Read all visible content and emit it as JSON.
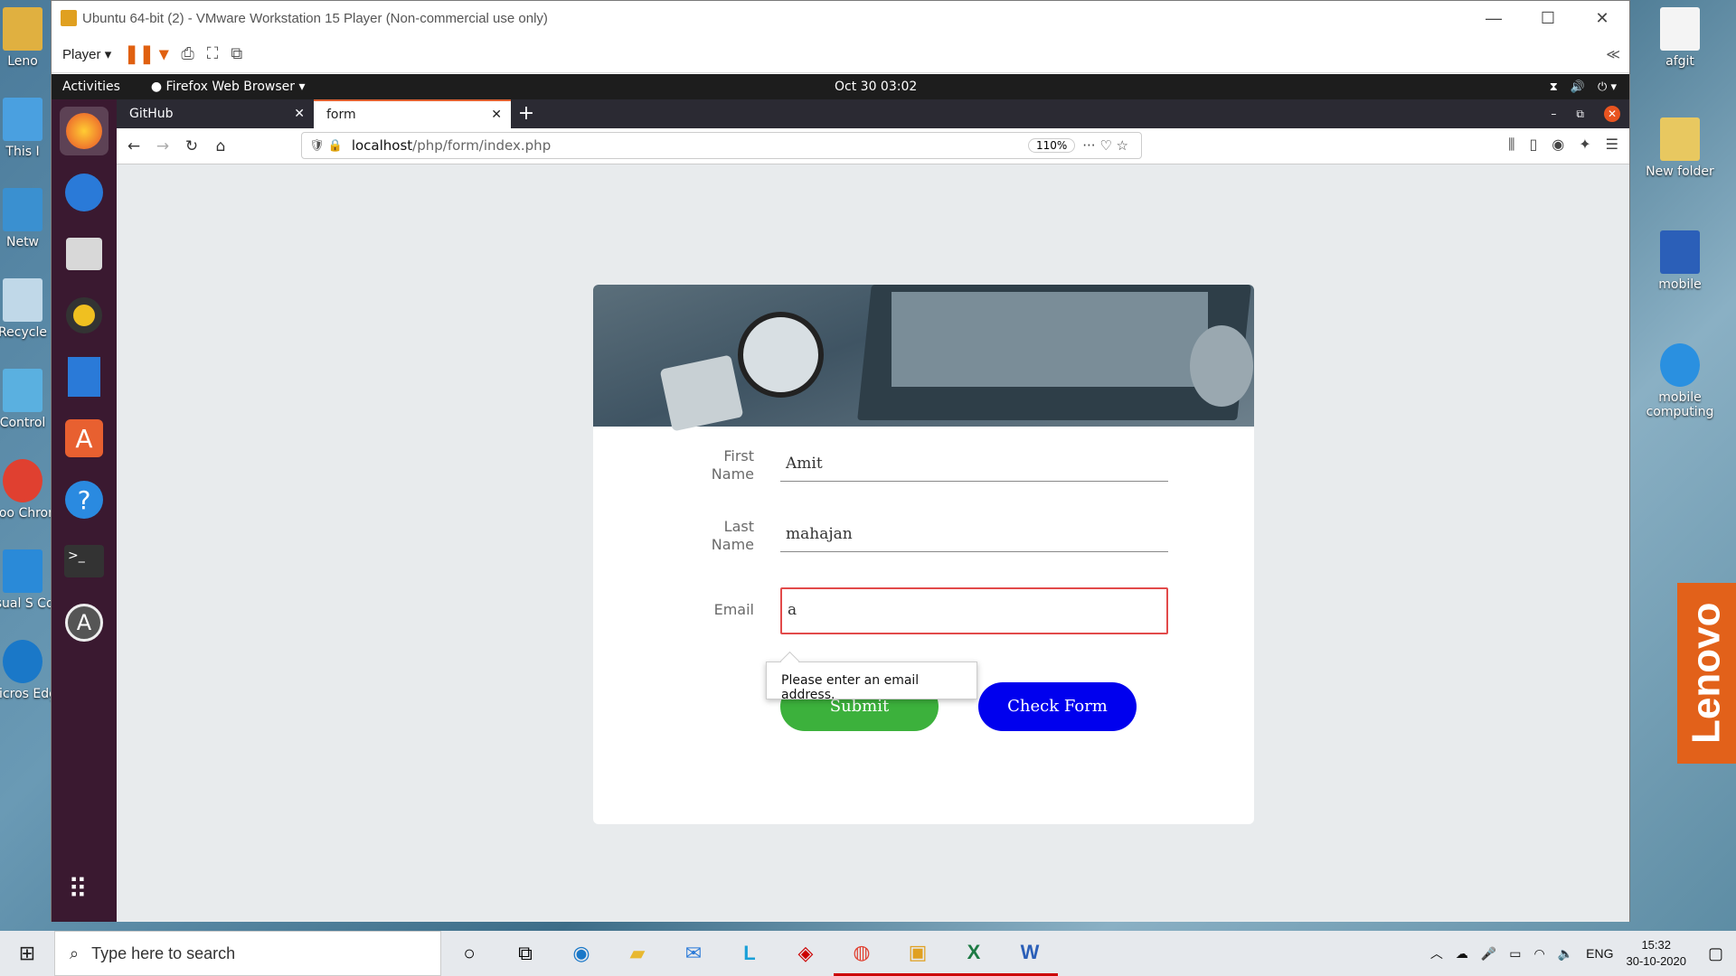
{
  "desktop": {
    "left_icons": [
      "Leno",
      "This I",
      "Netw",
      "Recycle",
      "Control",
      "Goo Chron",
      "Visual S Cod",
      "Micros Edg"
    ],
    "right_icons": [
      "afgit",
      "New folder",
      "mobile",
      "mobile computing"
    ],
    "brand": "Lenovo"
  },
  "vmware": {
    "title": "Ubuntu 64-bit (2) - VMware Workstation 15 Player (Non-commercial use only)",
    "player_menu": "Player"
  },
  "ubuntu": {
    "activities": "Activities",
    "app_menu": "Firefox Web Browser",
    "clock": "Oct 30  03:02"
  },
  "firefox": {
    "tabs": [
      {
        "label": "GitHub"
      },
      {
        "label": "form"
      }
    ],
    "url_host": "localhost",
    "url_path": "/php/form/index.php",
    "zoom": "110%"
  },
  "form": {
    "first_name_label": "First Name",
    "first_name_value": "Amit",
    "last_name_label": "Last Name",
    "last_name_value": "mahajan",
    "email_label": "Email",
    "email_value": "a",
    "tooltip": "Please enter an email address.",
    "submit_label": "Submit",
    "check_label": "Check Form",
    "colors": {
      "submit": "#3cb13c",
      "check": "#0000ee",
      "error": "#e24a4a"
    }
  },
  "taskbar": {
    "search_placeholder": "Type here to search",
    "lang": "ENG",
    "time": "15:32",
    "date": "30-10-2020"
  }
}
